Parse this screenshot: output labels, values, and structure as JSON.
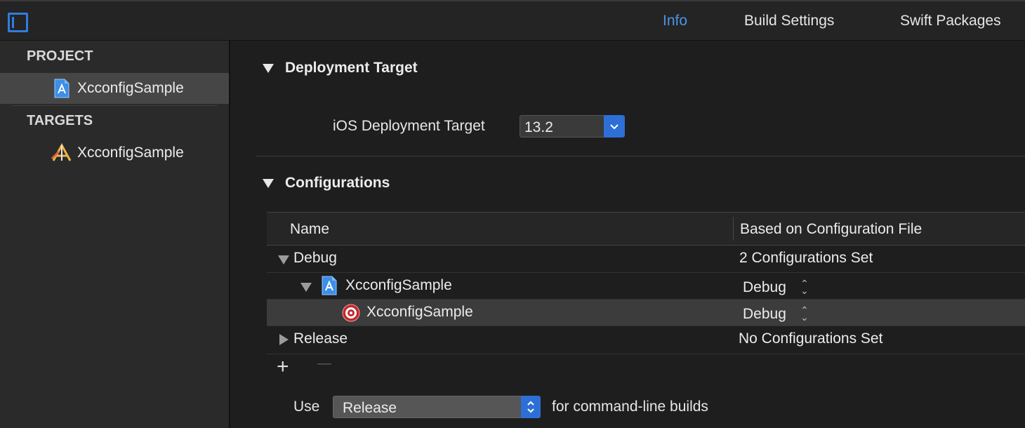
{
  "topbar": {
    "tabs": [
      {
        "label": "Info",
        "active": true
      },
      {
        "label": "Build Settings",
        "active": false
      },
      {
        "label": "Swift Packages",
        "active": false
      }
    ]
  },
  "sidebar": {
    "project_heading": "PROJECT",
    "project_item": "XcconfigSample",
    "targets_heading": "TARGETS",
    "target_item": "XcconfigSample"
  },
  "deployment": {
    "section_title": "Deployment Target",
    "label": "iOS Deployment Target",
    "value": "13.2"
  },
  "configurations": {
    "section_title": "Configurations",
    "columns": [
      "Name",
      "Based on Configuration File"
    ],
    "rows": [
      {
        "name": "Debug",
        "value": "2 Configurations Set"
      },
      {
        "name": "XcconfigSample",
        "value": "Debug"
      },
      {
        "name": "XcconfigSample",
        "value": "Debug"
      },
      {
        "name": "Release",
        "value": "No Configurations Set"
      }
    ],
    "add_label": "+",
    "remove_label": "—",
    "use_label": "Use",
    "use_value": "Release",
    "use_suffix": "for command-line builds"
  },
  "colors": {
    "accent": "#2f7de1",
    "background": "#1e1e1e",
    "sidebar": "#2a2a2a"
  },
  "icons": [
    "sidebar-toggle-icon",
    "xcodeproj-icon",
    "app-target-icon",
    "disclosure-icon",
    "target-icon",
    "stepper-icon",
    "chevron-down-icon"
  ]
}
